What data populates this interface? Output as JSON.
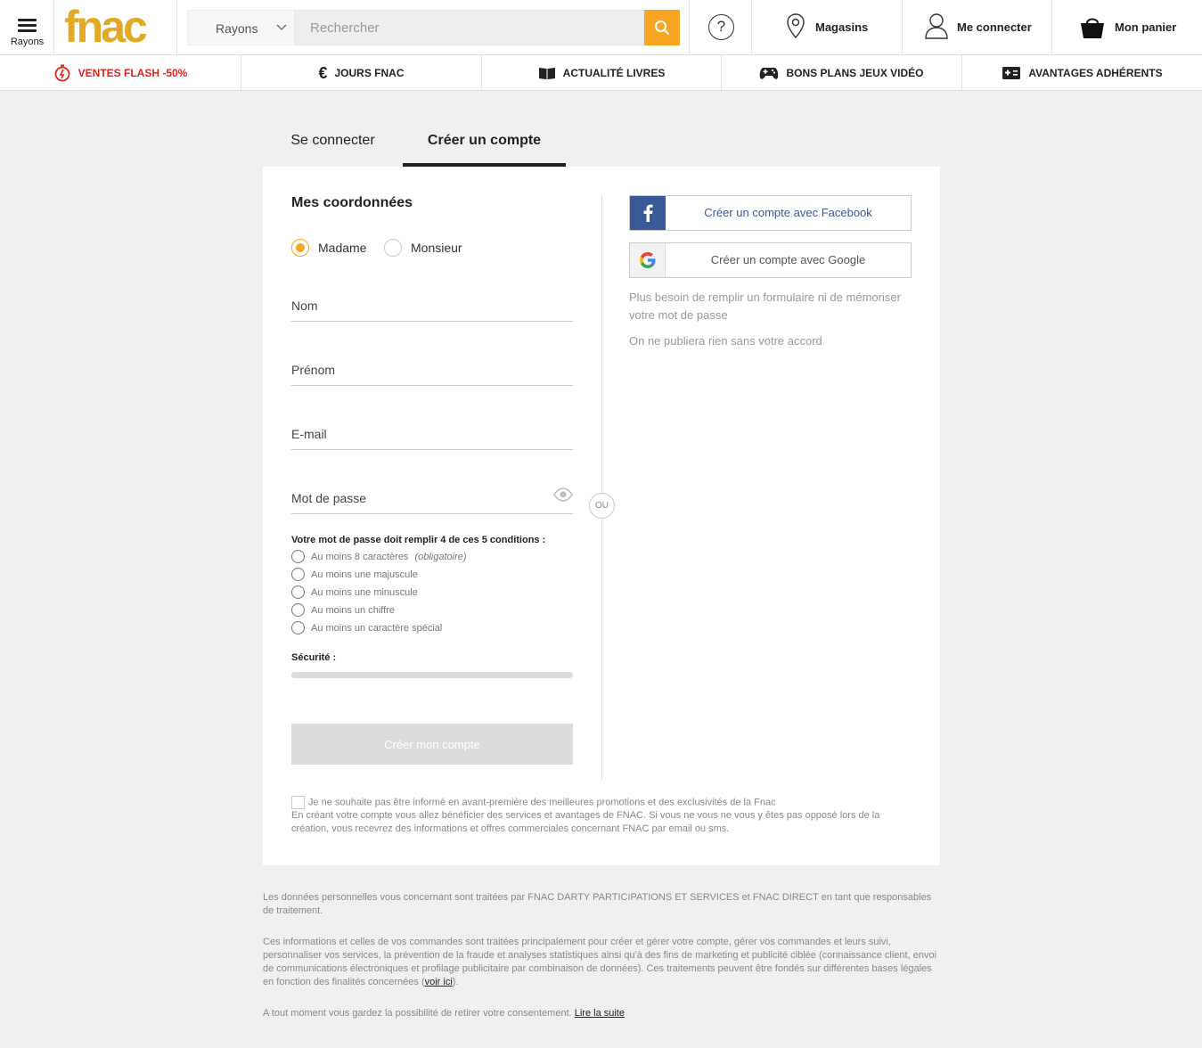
{
  "header": {
    "menu_label": "Rayons",
    "logo": "fnac",
    "rayons_label": "Rayons",
    "search_placeholder": "Rechercher",
    "help_glyph": "?",
    "stores_label": "Magasins",
    "login_label": "Me connecter",
    "cart_label": "Mon panier",
    "accent_color": "#f5a623",
    "logo_color": "#e1a925"
  },
  "nav": {
    "items": [
      {
        "label": "VENTES FLASH -50%",
        "icon": "stopwatch-icon"
      },
      {
        "label": "JOURS FNAC",
        "icon": "euro-icon"
      },
      {
        "label": "ACTUALITÉ LIVRES",
        "icon": "book-icon"
      },
      {
        "label": "BONS PLANS JEUX VIDÉO",
        "icon": "gamepad-icon"
      },
      {
        "label": "AVANTAGES ADHÉRENTS",
        "icon": "card-icon"
      }
    ],
    "flash_color": "#e2231a"
  },
  "tabs": {
    "login": "Se connecter",
    "register": "Créer un compte"
  },
  "form": {
    "section_title": "Mes coordonnées",
    "civility": {
      "options": [
        "Madame",
        "Monsieur"
      ],
      "selected": "Madame"
    },
    "fields": {
      "nom": "Nom",
      "prenom": "Prénom",
      "email": "E-mail",
      "password": "Mot de passe"
    },
    "password_rules_title": "Votre mot de passe doit remplir 4 de ces 5 conditions :",
    "password_rules": [
      {
        "text": "Au moins 8 caractères",
        "note": "(obligatoire)"
      },
      {
        "text": "Au moins une majuscule",
        "note": ""
      },
      {
        "text": "Au moins une minuscule",
        "note": ""
      },
      {
        "text": "Au moins un chiffre",
        "note": ""
      },
      {
        "text": "Au moins un caractère spécial",
        "note": ""
      }
    ],
    "security_label": "Sécurité :",
    "security_level": 0,
    "submit_label": "Créer mon compte",
    "or_label": "OU"
  },
  "social": {
    "facebook_label": "Créer un compte avec Facebook",
    "google_label": "Créer un compte avec Google",
    "note1": "Plus besoin de remplir un formulaire ni de mémoriser votre mot de passe",
    "note2": "On ne publiera rien sans votre accord",
    "facebook_color": "#3b5998"
  },
  "optout": {
    "checkbox_label": "Je ne souhaite pas être informé en avant-première des meilleures promotions et des exclusivités de la Fnac",
    "info": "En créant votre compte vous allez bénéficier des services et avantages de FNAC. Si vous ne vous ne vous y êtes pas opposé lors de la création, vous recevrez des informations et offres commerciales concernant FNAC par email ou sms."
  },
  "legal": {
    "p1": "Les données personnelles vous concernant sont traitées par FNAC DARTY PARTICIPATIONS ET SERVICES et FNAC DIRECT en tant que responsables de traitement.",
    "p2": "Ces informations et celles de vos commandes sont traitées principalement pour créer et gérer votre compte, gérer vos commandes et leurs suivi, personnaliser vos services, la prévention de la fraude et analyses statistiques ainsi qu'à des fins de marketing et publicité ciblée (connaissance client, envoi de communications électroniques et profilage publicitaire par combinaison de données). Ces traitements peuvent être fondés sur différentes bases légales en fonction des finalités concernées (",
    "p2_link": "voir ici",
    "p2_end": ").",
    "p3": "A tout moment vous gardez la possibilité de retirer votre consentement. ",
    "p3_link": "Lire la suite"
  }
}
